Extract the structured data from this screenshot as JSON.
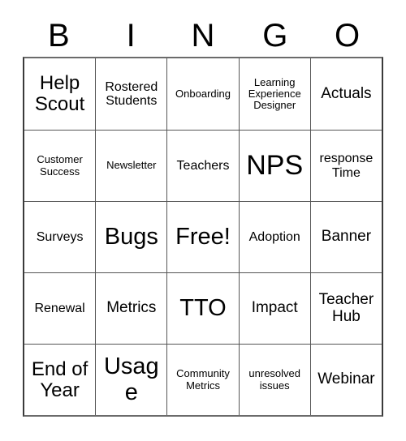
{
  "card": {
    "title": "Bingo Card",
    "header_letters": [
      "B",
      "I",
      "N",
      "G",
      "O"
    ],
    "colors": {
      "background": "#ffffff",
      "cell_background": "#ffffff",
      "text": "#000000",
      "grid_line": "#555555",
      "outer_border": "#3a3a3a"
    },
    "grid": {
      "columns": 5,
      "rows": 5,
      "rows_data": [
        {
          "cells": [
            {
              "text": "Help Scout",
              "size": "lg"
            },
            {
              "text": "Rostered Students",
              "size": "sm"
            },
            {
              "text": "Onboarding",
              "size": "xs"
            },
            {
              "text": "Learning Experience Designer",
              "size": "xs"
            },
            {
              "text": "Actuals",
              "size": "md"
            }
          ]
        },
        {
          "cells": [
            {
              "text": "Customer Success",
              "size": "xs"
            },
            {
              "text": "Newsletter",
              "size": "xs"
            },
            {
              "text": "Teachers",
              "size": "sm"
            },
            {
              "text": "NPS",
              "size": "xxl"
            },
            {
              "text": "response Time",
              "size": "sm"
            }
          ]
        },
        {
          "cells": [
            {
              "text": "Surveys",
              "size": "sm"
            },
            {
              "text": "Bugs",
              "size": "xl"
            },
            {
              "text": "Free!",
              "size": "xl"
            },
            {
              "text": "Adoption",
              "size": "sm"
            },
            {
              "text": "Banner",
              "size": "md"
            }
          ]
        },
        {
          "cells": [
            {
              "text": "Renewal",
              "size": "sm"
            },
            {
              "text": "Metrics",
              "size": "md"
            },
            {
              "text": "TTO",
              "size": "xl"
            },
            {
              "text": "Impact",
              "size": "md"
            },
            {
              "text": "Teacher Hub",
              "size": "md"
            }
          ]
        },
        {
          "cells": [
            {
              "text": "End of Year",
              "size": "lg"
            },
            {
              "text": "Usage",
              "size": "xl"
            },
            {
              "text": "Community Metrics",
              "size": "xs"
            },
            {
              "text": "unresolved issues",
              "size": "xs"
            },
            {
              "text": "Webinar",
              "size": "md"
            }
          ]
        }
      ]
    }
  }
}
